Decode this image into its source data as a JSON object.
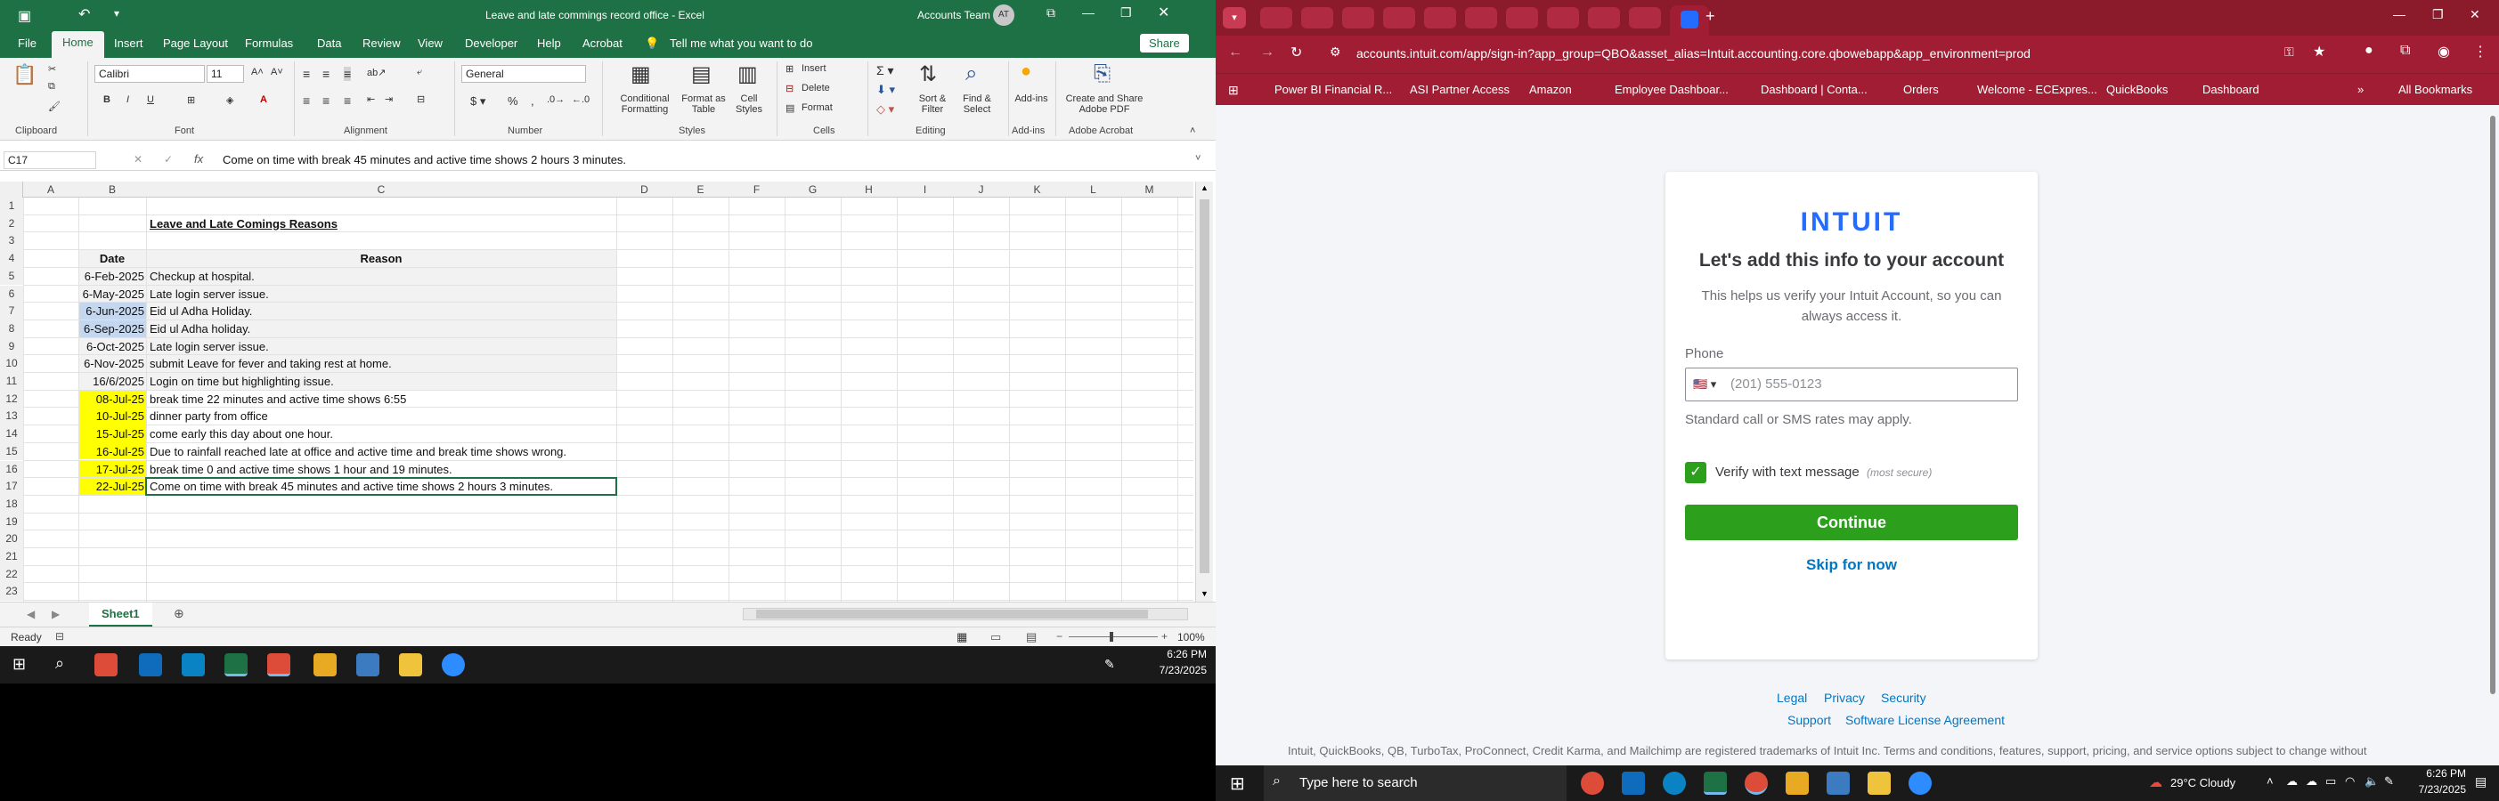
{
  "excel": {
    "title": "Leave and late commings record office  -  Excel",
    "account": "Accounts Team",
    "avatar": "AT",
    "menu": [
      "File",
      "Home",
      "Insert",
      "Page Layout",
      "Formulas",
      "Data",
      "Review",
      "View",
      "Developer",
      "Help",
      "Acrobat"
    ],
    "tell_me": "Tell me what you want to do",
    "share": "Share",
    "ribbon": {
      "font_name": "Calibri",
      "font_size": "11",
      "number_format": "General",
      "insert": "Insert",
      "delete": "Delete",
      "format": "Format",
      "conditional_formatting": "Conditional Formatting",
      "format_as_table": "Format as Table",
      "cell_styles": "Cell Styles",
      "sort_filter": "Sort & Filter",
      "find_select": "Find & Select",
      "addins": "Add-ins",
      "create_share": "Create and Share Adobe PDF",
      "groups": [
        "Clipboard",
        "Font",
        "Alignment",
        "Number",
        "Styles",
        "Cells",
        "Editing",
        "Add-ins",
        "Adobe Acrobat"
      ]
    },
    "name_box": "C17",
    "formula": "Come on time with break 45 minutes and active time shows 2 hours 3 minutes.",
    "columns": [
      "A",
      "B",
      "C",
      "D",
      "E",
      "F",
      "G",
      "H",
      "I",
      "J",
      "K",
      "L",
      "M"
    ],
    "rows": [
      "1",
      "2",
      "3",
      "4",
      "5",
      "6",
      "7",
      "8",
      "9",
      "10",
      "11",
      "12",
      "13",
      "14",
      "15",
      "16",
      "17",
      "18",
      "19",
      "20",
      "21",
      "22",
      "23"
    ],
    "sheet_title": "Leave and Late Comings Reasons",
    "header_date": "Date",
    "header_reason": "Reason",
    "records": [
      {
        "date": "6-Feb-2025",
        "reason": "Checkup at hospital."
      },
      {
        "date": "6-May-2025",
        "reason": "Late login server issue."
      },
      {
        "date": "6-Jun-2025",
        "reason": "Eid ul Adha Holiday."
      },
      {
        "date": "6-Sep-2025",
        "reason": "Eid ul Adha holiday."
      },
      {
        "date": "6-Oct-2025",
        "reason": "Late login server issue."
      },
      {
        "date": "6-Nov-2025",
        "reason": "submit Leave for fever and taking rest at  home."
      },
      {
        "date": "16/6/2025",
        "reason": "Login on time but highlighting issue."
      },
      {
        "date": "08-Jul-25",
        "reason": "break time 22 minutes and active time shows 6:55"
      },
      {
        "date": "10-Jul-25",
        "reason": "dinner party from office"
      },
      {
        "date": "15-Jul-25",
        "reason": "come early this day about one hour."
      },
      {
        "date": "16-Jul-25",
        "reason": "Due to rainfall reached late at office and active time and break time shows wrong."
      },
      {
        "date": "17-Jul-25",
        "reason": "break time 0 and active time shows 1 hour and 19 minutes."
      },
      {
        "date": "22-Jul-25",
        "reason": "Come on time with break 45 minutes and active time shows 2 hours 3 minutes."
      }
    ],
    "sheet_tab": "Sheet1",
    "status": "Ready",
    "zoom": "100%",
    "time": "6:26 PM",
    "date": "7/23/2025"
  },
  "chrome": {
    "url": "accounts.intuit.com/app/sign-in?app_group=QBO&asset_alias=Intuit.accounting.core.qbowebapp&app_environment=prod",
    "bookmarks": [
      "Power BI Financial R...",
      "ASI Partner Access",
      "Amazon",
      "Employee Dashboar...",
      "Dashboard | Conta...",
      "Orders",
      "Welcome - ECExpres...",
      "QuickBooks",
      "Dashboard"
    ],
    "all_bookmarks": "All Bookmarks",
    "logo": "INTUIT",
    "heading": "Let's add this info to your account",
    "subtext": "This helps us verify your Intuit Account, so you can always access it.",
    "phone_label": "Phone",
    "phone_placeholder": "(201) 555-0123",
    "flag": "🇺🇸 ▾",
    "rates": "Standard call or SMS rates may apply.",
    "verify": "Verify with text message",
    "verify_note": "(most secure)",
    "continue": "Continue",
    "skip": "Skip for now",
    "footer_links": [
      "Legal",
      "Privacy",
      "Security"
    ],
    "footer_links2": [
      "Support",
      "Software License Agreement"
    ],
    "trademark": "Intuit, QuickBooks, QB, TurboTax, ProConnect, Credit Karma, and Mailchimp are registered trademarks of Intuit Inc. Terms and conditions, features, support, pricing, and service options subject to change without"
  },
  "taskbar": {
    "search_placeholder": "Type here to search",
    "weather": "29°C  Cloudy",
    "time": "6:26 PM",
    "date": "7/23/2025"
  },
  "colors": {
    "excel_green": "#1e7145",
    "chrome_red": "#a11d33",
    "intuit_blue": "#236cff",
    "continue_green": "#2ca01c",
    "yellow": "#ffff00"
  }
}
